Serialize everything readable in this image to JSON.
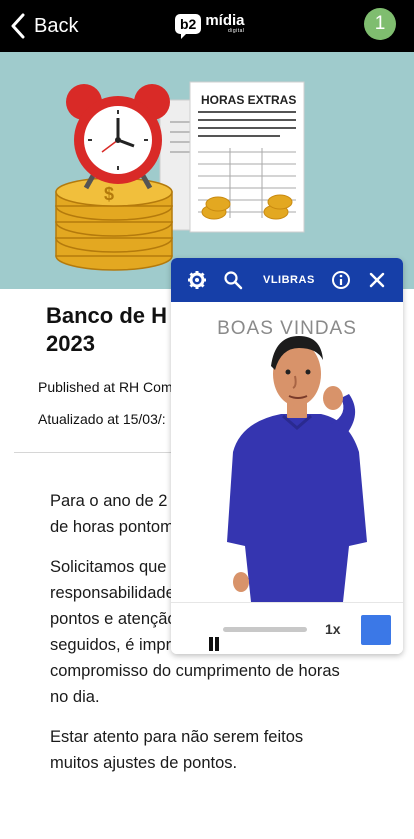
{
  "header": {
    "back_label": "Back",
    "logo_badge": "b2",
    "logo_text": "mídia",
    "logo_sub": "digital",
    "avatar_text": "1"
  },
  "hero": {
    "document_title": "HORAS EXTRAS"
  },
  "article": {
    "title": "Banco de H 2023",
    "title_line1": "Banco de H",
    "title_line2": "2023",
    "published": "Published at RH Com",
    "updated": "Atualizado at 15/03/:",
    "paragraphs": [
      "Para o ano de 2 algumas norma banco de horas pontomais.",
      "Solicitamos que tenham responsabilidades nas marcações de pontos e atenção nos horários a ser seguidos, é imprescindível o compromisso do cumprimento de horas no dia.",
      "Estar atento para não serem feitos muitos ajustes de pontos."
    ]
  },
  "vlibras": {
    "title": "VLIBRAS",
    "welcome": "BOAS VINDAS",
    "speed": "1x"
  },
  "colors": {
    "topbar": "#000000",
    "hero_bg": "#9fcbcc",
    "vlibras_bar": "#163fa8",
    "avatar": "#7fbd6f",
    "accent_square": "#3b78e7"
  }
}
